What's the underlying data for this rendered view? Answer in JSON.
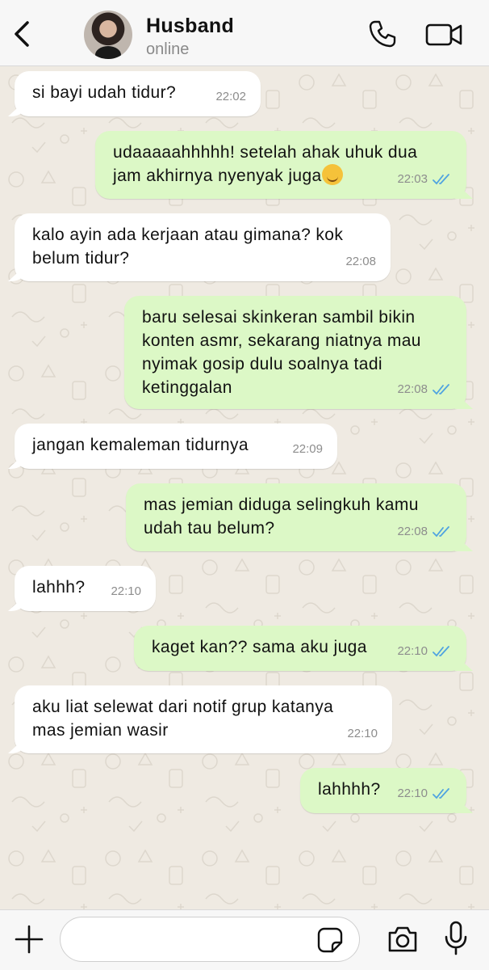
{
  "header": {
    "contact_name": "Husband",
    "status": "online",
    "icons": {
      "back": "chevron-left-icon",
      "avatar": "contact-photo",
      "call": "phone-icon",
      "video": "video-camera-icon"
    }
  },
  "messages": [
    {
      "direction": "incoming",
      "text": "si bayi udah tidur?",
      "time": "22:02"
    },
    {
      "direction": "outgoing",
      "text": "udaaaaahhhhh! setelah ahak uhuk dua\njam akhirnya nyenyak juga",
      "emoji": "face-holding-back-tears-emoji",
      "time": "22:03",
      "read": true
    },
    {
      "direction": "incoming",
      "text": "kalo ayin ada kerjaan atau gimana? kok\nbelum tidur?",
      "time": "22:08"
    },
    {
      "direction": "outgoing",
      "text": "baru selesai skinkeran sambil bikin\nkonten asmr, sekarang niatnya mau\nnyimak gosip dulu soalnya tadi\nketinggalan",
      "time": "22:08",
      "read": true
    },
    {
      "direction": "incoming",
      "text": "jangan kemaleman tidurnya",
      "time": "22:09"
    },
    {
      "direction": "outgoing",
      "text": "mas jemian diduga selingkuh kamu\nudah tau belum?",
      "time": "22:08",
      "read": true
    },
    {
      "direction": "incoming",
      "text": "lahhh?",
      "time": "22:10"
    },
    {
      "direction": "outgoing",
      "text": "kaget kan?? sama aku juga",
      "time": "22:10",
      "read": true
    },
    {
      "direction": "incoming",
      "text": "aku liat selewat dari notif grup katanya\nmas jemian wasir",
      "time": "22:10"
    },
    {
      "direction": "outgoing",
      "text": "lahhhh?",
      "time": "22:10",
      "read": true
    }
  ],
  "composer": {
    "placeholder": "",
    "icons": {
      "add": "plus-icon",
      "sticker": "sticker-icon",
      "camera": "camera-icon",
      "mic": "microphone-icon"
    }
  },
  "colors": {
    "outgoing_bubble": "#dcf8c6",
    "incoming_bubble": "#ffffff",
    "chat_background": "#efeae2",
    "read_ticks": "#4fa3e0",
    "header_background": "#f7f7f7"
  }
}
